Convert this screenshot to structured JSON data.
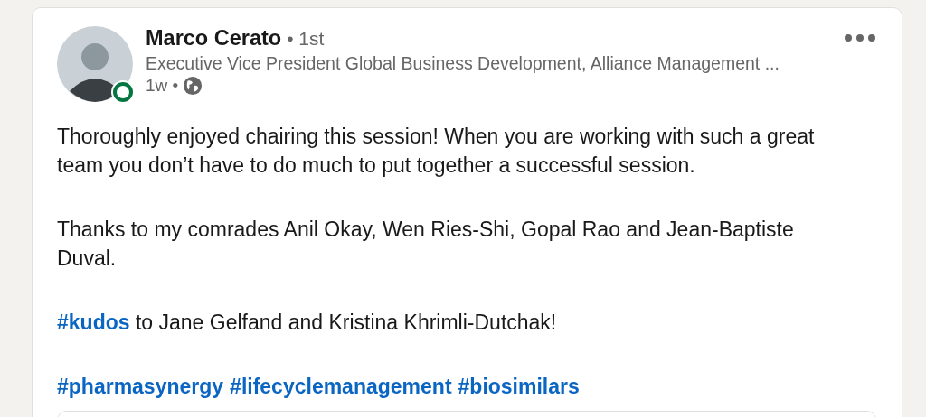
{
  "post": {
    "author": {
      "name": "Marco Cerato",
      "degree": "• 1st",
      "online": true,
      "headline": "Executive Vice President Global Business Development, Alliance Management ...",
      "age": "1w •"
    },
    "paragraphs": [
      {
        "kind": "text",
        "segments": [
          {
            "kind": "text",
            "text": "Thoroughly enjoyed chairing this session! When you are working with such a great team you don’t have to do much to put together a successful session."
          }
        ]
      },
      {
        "kind": "text",
        "segments": [
          {
            "kind": "text",
            "text": "Thanks to my comrades Anil Okay, Wen Ries-Shi, Gopal Rao and Jean-Baptiste Duval."
          }
        ]
      },
      {
        "kind": "text",
        "segments": [
          {
            "kind": "hashtag",
            "text": "#kudos"
          },
          {
            "kind": "text",
            "text": " to Jane Gelfand and Kristina Khrimli-Dutchak!"
          }
        ]
      },
      {
        "kind": "tags",
        "tags": [
          "#pharmasynergy",
          "#lifecyclemanagement",
          "#biosimilars"
        ]
      }
    ]
  }
}
